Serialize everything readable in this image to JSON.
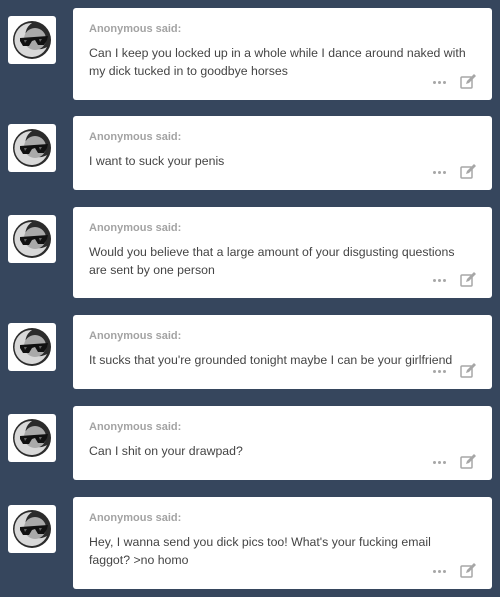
{
  "asks": [
    {
      "asker": "Anonymous said:",
      "question": "Can I keep you locked up in a whole while I dance around naked with my dick tucked in to goodbye horses"
    },
    {
      "asker": "Anonymous said:",
      "question": "I want to suck your penis"
    },
    {
      "asker": "Anonymous said:",
      "question": "Would you believe that a large amount of your disgusting questions are sent by one person"
    },
    {
      "asker": "Anonymous said:",
      "question": "It sucks that you're grounded tonight maybe I can be your girlfriend"
    },
    {
      "asker": "Anonymous said:",
      "question": "Can I shit on your drawpad?"
    },
    {
      "asker": "Anonymous said:",
      "question": "Hey, I wanna send you dick pics too! What's your fucking email faggot? >no homo"
    }
  ],
  "icons": {
    "avatar": "anonymous-sunglasses-icon",
    "more": "more-dots-icon",
    "edit": "edit-icon"
  },
  "colors": {
    "background": "#36465d",
    "card": "#ffffff",
    "asker": "#a3a3a3",
    "text": "#444444"
  }
}
